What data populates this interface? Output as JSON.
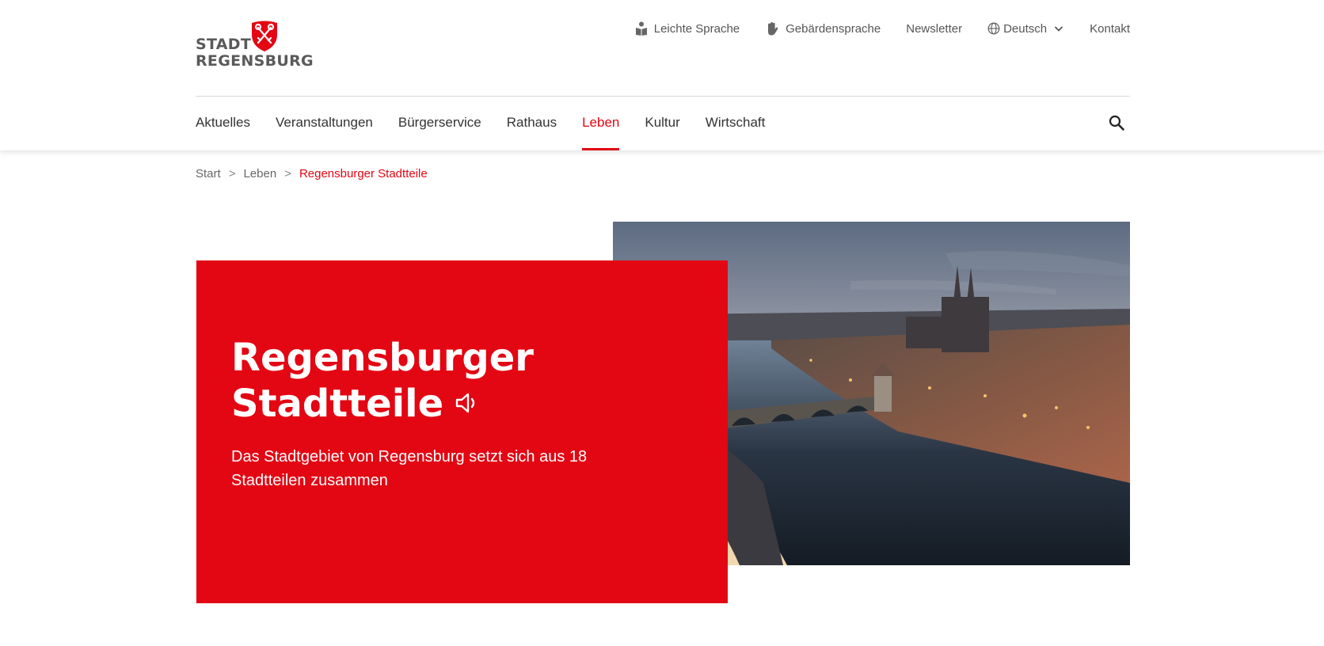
{
  "logo": {
    "line1": "STADT",
    "line2": "REGENSBURG",
    "shield_color": "#e30613"
  },
  "utility_nav": [
    {
      "label": "Leichte Sprache",
      "icon": "reading-book-icon"
    },
    {
      "label": "Gebärdensprache",
      "icon": "sign-language-hand-icon"
    },
    {
      "label": "Newsletter"
    },
    {
      "label": "Deutsch",
      "icon": "globe-icon",
      "dropdown": true
    },
    {
      "label": "Kontakt"
    }
  ],
  "main_nav": [
    {
      "label": "Aktuelles"
    },
    {
      "label": "Veranstaltungen"
    },
    {
      "label": "Bürgerservice"
    },
    {
      "label": "Rathaus"
    },
    {
      "label": "Leben",
      "active": true
    },
    {
      "label": "Kultur"
    },
    {
      "label": "Wirtschaft"
    }
  ],
  "search": {
    "icon": "search-icon"
  },
  "breadcrumb": [
    {
      "label": "Start"
    },
    {
      "label": "Leben"
    },
    {
      "label": "Regensburger Stadtteile",
      "current": true
    }
  ],
  "breadcrumb_separator": ">",
  "hero": {
    "title_line1": "Regensburger",
    "title_line2": "Stadtteile",
    "audio_icon": "speaker-icon",
    "text": "Das Stadtgebiet von Regensburg setzt sich aus 18 Stadtteilen zusammen",
    "card_color": "#e30613",
    "image": "aerial-cityscape-regensburg-cathedral-stone-bridge-dusk"
  },
  "colors": {
    "accent": "#e30613",
    "text": "#333333",
    "muted": "#666666"
  }
}
